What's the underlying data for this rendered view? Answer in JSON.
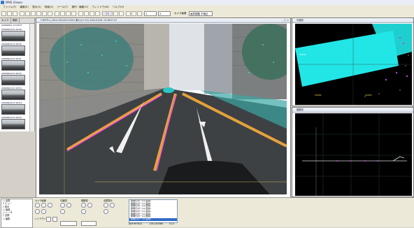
{
  "app": {
    "title": "MMS Viewer"
  },
  "menu": [
    "ファイル(F)",
    "編集(E)",
    "表示(V)",
    "検索(S)",
    "ツール(T)",
    "操作・編集(O)",
    "ウィンドウ(W)",
    "ヘルプ(H)"
  ],
  "toolbar": {
    "select1": "1",
    "select2": "3",
    "select_label": "カメラ画像",
    "select3": "画質調整 不適正"
  },
  "left_pane": {
    "tabs": [
      "カメラ",
      "地図"
    ],
    "header_text": "20000001 13:18:57",
    "thumbnails": [
      "2000000113:18:49",
      "2000000113:18:50",
      "2000000113:18:51",
      "2000000113:18:52",
      "2000000113:18:53",
      "2000000113:18:54",
      "2000000113:18:55"
    ]
  },
  "image_window": {
    "title": "F:\\MTTL2_20111201\\20111201 第1(カメラ1) 2011/12/01 13:18:57.47",
    "buttons": "_ □ ×"
  },
  "top_right_window": {
    "title": "平面図",
    "labels": [
      "92245",
      "25655",
      "25655"
    ]
  },
  "bottom_right_window": {
    "title": "縦断図"
  },
  "bottom_panel": {
    "tree": [
      "□ 全般",
      "  ├ ビュー",
      "  ├ 表示",
      "□ 画像",
      "□ レーザ",
      "  ├ 点群",
      "□ 編集"
    ],
    "groups": [
      "カメラ画像",
      "平面図",
      "縦断図",
      "点群表示"
    ],
    "layout_label": "レイアウト",
    "status_values": [
      "A09.997621",
      "-235.187089",
      "0.13"
    ],
    "list_items": [
      "照明灯(ポール)(直線)",
      "照明灯(ポール)(直線)",
      "照明灯(ポール)(直線)",
      "照明灯(ポール)(直線)",
      "照明灯(ポール)(直線)",
      "照明灯(ポール)(直線)",
      "照明灯(ポール)(直線)",
      "照明灯(ポール)(直線)"
    ]
  }
}
